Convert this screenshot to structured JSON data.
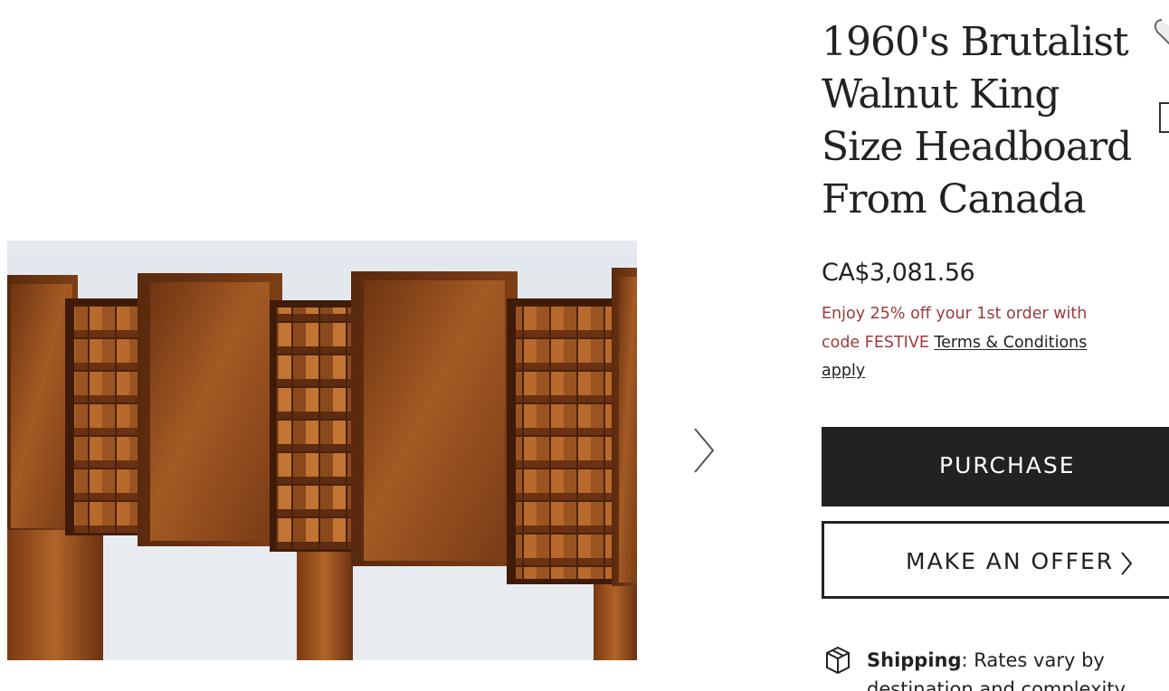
{
  "product": {
    "title": "1960's Brutalist Walnut King Size Headboard From Canada",
    "price": "CA$3,081.56",
    "image_alt": "1960's Brutalist Walnut King Size Headboard From Canada"
  },
  "promo": {
    "text": "Enjoy 25% off your 1st order with code FESTIVE ",
    "link_label": "Terms & Conditions apply"
  },
  "actions": {
    "purchase_label": "PURCHASE",
    "offer_label": "MAKE AN OFFER"
  },
  "shipping": {
    "label": "Shipping",
    "detail": ": Rates vary by destination and complexity"
  },
  "icons": {
    "next": "chevron-right-icon",
    "favorite": "heart-icon",
    "share": "share-icon",
    "shipping": "box-icon"
  },
  "colors": {
    "button_dark": "#222222",
    "promo_text": "#9b3b3b",
    "wood": "#8b4a1c"
  }
}
